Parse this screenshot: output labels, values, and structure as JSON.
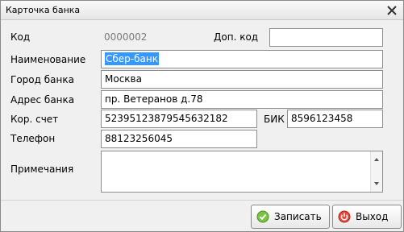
{
  "window": {
    "title": "Карточка банка"
  },
  "labels": {
    "code": "Код",
    "extra_code": "Доп. код",
    "name": "Наименование",
    "city": "Город банка",
    "address": "Адрес банка",
    "corr_account": "Кор. счет",
    "bik": "БИК",
    "phone": "Телефон",
    "notes": "Примечания"
  },
  "values": {
    "code": "0000002",
    "extra_code": "",
    "name": "Сбер-банк",
    "city": "Москва",
    "address": "пр. Ветеранов д.78",
    "corr_account": "52395123879545632182",
    "bik": "8596123458",
    "phone": "88123256045",
    "notes": ""
  },
  "buttons": {
    "save": "Записать",
    "exit": "Выход"
  },
  "icons": {
    "close": "close-icon",
    "save": "check-circle-icon",
    "exit": "power-icon"
  }
}
